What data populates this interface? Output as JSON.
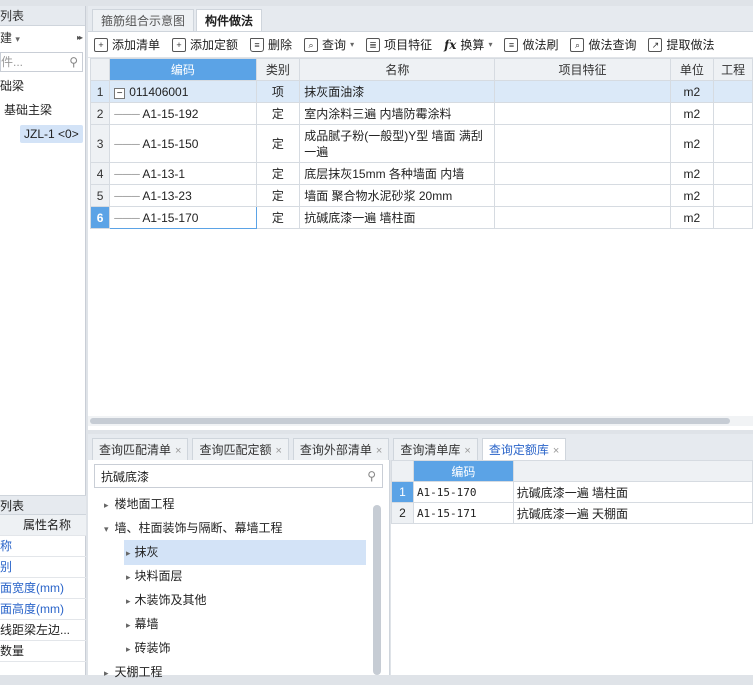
{
  "left_panel": {
    "header": "列表",
    "tool_label": "建",
    "tool_caret": "▾",
    "collapse_arrow": "▸▸",
    "search_placeholder": "件...",
    "tree": [
      {
        "label": "础梁",
        "level": 0
      },
      {
        "label": "基础主梁",
        "level": 1
      },
      {
        "label": "JZL-1 <0>",
        "level": 2,
        "selected": true
      }
    ],
    "props_header": "列表",
    "props_col": "属性名称",
    "props": [
      {
        "label": "称",
        "blue": true
      },
      {
        "label": "别",
        "blue": true
      },
      {
        "label": "面宽度(mm)",
        "blue": true
      },
      {
        "label": "面高度(mm)",
        "blue": true
      },
      {
        "label": "线距梁左边...",
        "blue": false
      },
      {
        "label": "数量",
        "blue": false
      }
    ]
  },
  "main": {
    "tabs": [
      {
        "label": "箍筋组合示意图",
        "active": false
      },
      {
        "label": "构件做法",
        "active": true
      }
    ],
    "toolbar": [
      {
        "label": "添加清单",
        "icon": "add-list-icon",
        "caret": false
      },
      {
        "label": "添加定额",
        "icon": "add-quota-icon",
        "caret": false
      },
      {
        "label": "删除",
        "icon": "delete-icon",
        "caret": false
      },
      {
        "label": "查询",
        "icon": "query-icon",
        "caret": true
      },
      {
        "label": "项目特征",
        "icon": "feature-icon",
        "caret": false
      },
      {
        "label": "换算",
        "icon": "fx-icon",
        "caret": true
      },
      {
        "label": "做法刷",
        "icon": "brush-icon",
        "caret": false
      },
      {
        "label": "做法查询",
        "icon": "method-query-icon",
        "caret": false
      },
      {
        "label": "提取做法",
        "icon": "extract-icon",
        "caret": false
      }
    ],
    "columns": [
      "编码",
      "类别",
      "名称",
      "项目特征",
      "单位",
      "工程"
    ],
    "rows": [
      {
        "n": "1",
        "code": "011406001",
        "type": "项",
        "name": "抹灰面油漆",
        "feature": "",
        "unit": "m2",
        "collapsible": true
      },
      {
        "n": "2",
        "code": "A1-15-192",
        "type": "定",
        "name": "室内涂料三遍 内墙防霉涂料",
        "feature": "",
        "unit": "m2"
      },
      {
        "n": "3",
        "code": "A1-15-150",
        "type": "定",
        "name": "成品腻子粉(一般型)Y型 墙面 满刮一遍",
        "feature": "",
        "unit": "m2"
      },
      {
        "n": "4",
        "code": "A1-13-1",
        "type": "定",
        "name": "底层抹灰15mm 各种墙面 内墙",
        "feature": "",
        "unit": "m2"
      },
      {
        "n": "5",
        "code": "A1-13-23",
        "type": "定",
        "name": "墙面 聚合物水泥砂浆 20mm",
        "feature": "",
        "unit": "m2"
      },
      {
        "n": "6",
        "code": "A1-15-170",
        "type": "定",
        "name": "抗碱底漆一遍 墙柱面",
        "feature": "",
        "unit": "m2"
      }
    ],
    "collapse_symbol": "−"
  },
  "bottom": {
    "tabs": [
      {
        "label": "查询匹配清单",
        "active": false
      },
      {
        "label": "查询匹配定额",
        "active": false
      },
      {
        "label": "查询外部清单",
        "active": false
      },
      {
        "label": "查询清单库",
        "active": false
      },
      {
        "label": "查询定额库",
        "active": true
      }
    ],
    "close_symbol": "×",
    "search_value": "抗碱底漆",
    "tree": [
      {
        "label": "楼地面工程",
        "arrow": "▸",
        "level": 0
      },
      {
        "label": "墙、柱面装饰与隔断、幕墙工程",
        "arrow": "▾",
        "level": 0
      },
      {
        "label": "抹灰",
        "arrow": "▸",
        "level": 1,
        "selected": true
      },
      {
        "label": "块料面层",
        "arrow": "▸",
        "level": 1
      },
      {
        "label": "木装饰及其他",
        "arrow": "▸",
        "level": 1
      },
      {
        "label": "幕墙",
        "arrow": "▸",
        "level": 1
      },
      {
        "label": "砖装饰",
        "arrow": "▸",
        "level": 1
      },
      {
        "label": "天棚工程",
        "arrow": "▸",
        "level": 0
      }
    ],
    "results_header": "编码",
    "results": [
      {
        "n": "1",
        "code": "A1-15-170",
        "name": "抗碱底漆一遍 墙柱面"
      },
      {
        "n": "2",
        "code": "A1-15-171",
        "name": "抗碱底漆一遍 天棚面"
      }
    ]
  }
}
